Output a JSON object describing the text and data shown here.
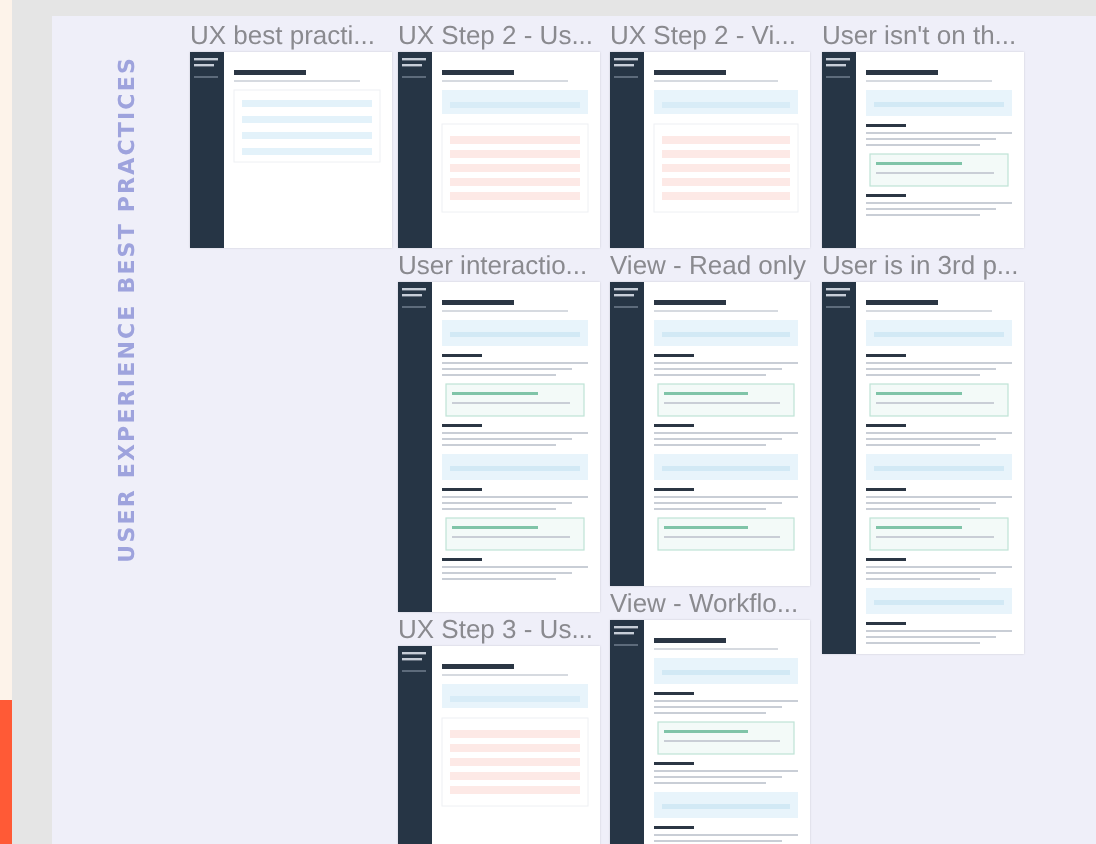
{
  "section": {
    "label": "USER EXPERIENCE BEST PRACTICES"
  },
  "frames": [
    {
      "title": "UX best practi...",
      "kind": "intro"
    },
    {
      "title": "UX Step 2 - Us...",
      "kind": "steps"
    },
    {
      "title": "UX Step 2 - Vi...",
      "kind": "steps"
    },
    {
      "title": "User isn't on th...",
      "kind": "article"
    },
    {
      "title": "User interactio...",
      "kind": "article"
    },
    {
      "title": "View - Read only",
      "kind": "article"
    },
    {
      "title": "User is in 3rd p...",
      "kind": "article"
    },
    {
      "title": "UX Step 3 - Us...",
      "kind": "steps"
    },
    {
      "title": "View - Workflo...",
      "kind": "article"
    }
  ]
}
